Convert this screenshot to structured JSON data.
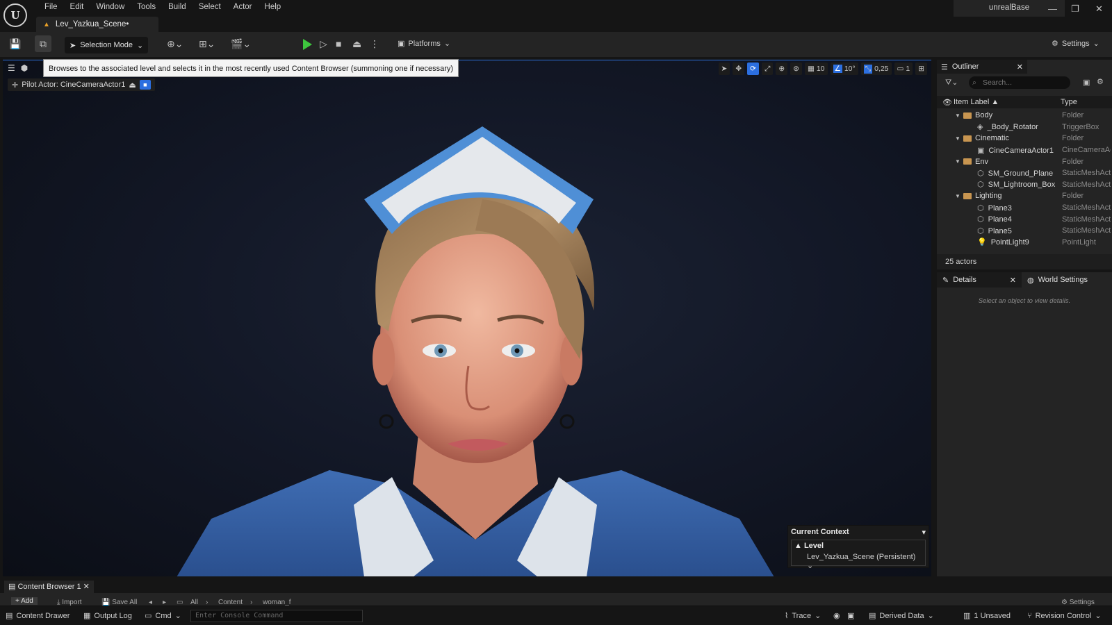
{
  "app": {
    "menu": [
      "File",
      "Edit",
      "Window",
      "Tools",
      "Build",
      "Select",
      "Actor",
      "Help"
    ],
    "document_tab": "Lev_Yazkua_Scene•",
    "project_name": "unrealBase"
  },
  "toolbar": {
    "selection_mode": "Selection Mode",
    "platforms": "Platforms",
    "settings": "Settings"
  },
  "viewport": {
    "tooltip": "Browses to the associated level and selects it in the most recently used Content Browser (summoning one if necessary)",
    "pilot_actor": "Pilot Actor: CineCameraActor1",
    "grid_size": "10",
    "rotation_snap": "10°",
    "scale_snap": "0,25",
    "camera_speed": "1",
    "context": {
      "title": "Current Context",
      "level_label": "Level",
      "level_value": "Lev_Yazkua_Scene (Persistent)"
    }
  },
  "outliner": {
    "tab": "Outliner",
    "search_placeholder": "Search...",
    "col_label": "Item Label ▲",
    "col_type": "Type",
    "rows": [
      {
        "label": "Body",
        "type": "Folder",
        "kind": "folder",
        "depth": 1
      },
      {
        "label": "_Body_Rotator",
        "type": "TriggerBox",
        "kind": "actor",
        "depth": 2
      },
      {
        "label": "Cinematic",
        "type": "Folder",
        "kind": "folder",
        "depth": 1
      },
      {
        "label": "CineCameraActor1",
        "type": "CineCameraActor",
        "kind": "camera",
        "depth": 2
      },
      {
        "label": "Env",
        "type": "Folder",
        "kind": "folder",
        "depth": 1
      },
      {
        "label": "SM_Ground_Plane",
        "type": "StaticMeshActor",
        "kind": "mesh",
        "depth": 2
      },
      {
        "label": "SM_Lightroom_Box",
        "type": "StaticMeshActor",
        "kind": "mesh",
        "depth": 2
      },
      {
        "label": "Lighting",
        "type": "Folder",
        "kind": "folder",
        "depth": 1
      },
      {
        "label": "Plane3",
        "type": "StaticMeshActor",
        "kind": "mesh",
        "depth": 2
      },
      {
        "label": "Plane4",
        "type": "StaticMeshActor",
        "kind": "mesh",
        "depth": 2
      },
      {
        "label": "Plane5",
        "type": "StaticMeshActor",
        "kind": "mesh",
        "depth": 2
      },
      {
        "label": "PointLight9",
        "type": "PointLight",
        "kind": "light",
        "depth": 2
      }
    ],
    "footer": "25 actors"
  },
  "details": {
    "tab_details": "Details",
    "tab_world": "World Settings",
    "empty_text": "Select an object to view details."
  },
  "content_browser": {
    "tab": "Content Browser 1",
    "add": "Add",
    "import": "Import",
    "save_all": "Save All",
    "path": [
      "All",
      "Content",
      "woman_f"
    ],
    "settings": "Settings"
  },
  "statusbar": {
    "content_drawer": "Content Drawer",
    "output_log": "Output Log",
    "cmd": "Cmd",
    "console_placeholder": "Enter Console Command",
    "trace": "Trace",
    "derived_data": "Derived Data",
    "unsaved": "1 Unsaved",
    "revision_control": "Revision Control"
  },
  "colors": {
    "accent": "#2c6fe0",
    "play": "#3ec63e",
    "folder": "#c89550",
    "warning": "#e8a028"
  }
}
